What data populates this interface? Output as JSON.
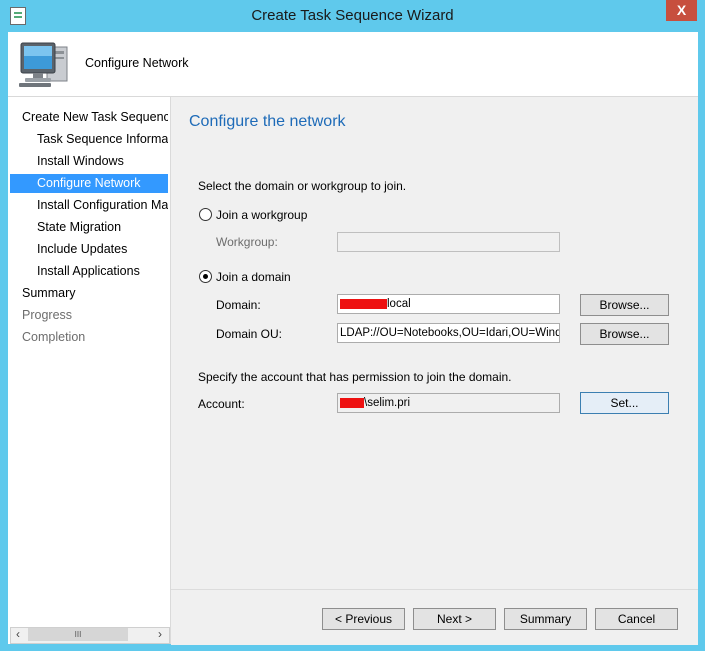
{
  "window": {
    "title": "Create Task Sequence Wizard",
    "close_glyph": "X"
  },
  "header": {
    "title": "Configure Network",
    "icon": "computer-icon"
  },
  "nav": {
    "items": [
      {
        "label": "Create New Task Sequence",
        "state": "normal"
      },
      {
        "label": "Task Sequence Information",
        "state": "normal"
      },
      {
        "label": "Install Windows",
        "state": "normal"
      },
      {
        "label": "Configure Network",
        "state": "selected"
      },
      {
        "label": "Install Configuration Manager",
        "state": "normal"
      },
      {
        "label": "State Migration",
        "state": "normal"
      },
      {
        "label": "Include Updates",
        "state": "normal"
      },
      {
        "label": "Install Applications",
        "state": "normal"
      },
      {
        "label": "Summary",
        "state": "normal"
      },
      {
        "label": "Progress",
        "state": "disabled"
      },
      {
        "label": "Completion",
        "state": "disabled"
      }
    ],
    "scroll_thumb_glyph": "III"
  },
  "page": {
    "heading": "Configure the network",
    "instruction": "Select the domain or workgroup to join.",
    "workgroup_option": "Join a workgroup",
    "workgroup_label": "Workgroup:",
    "workgroup_value": "",
    "domain_option": "Join a domain",
    "selected_option": "domain",
    "domain_label": "Domain:",
    "domain_value_suffix": "local",
    "domain_ou_label": "Domain OU:",
    "domain_ou_value": "LDAP://OU=Notebooks,OU=Idari,OU=Windows",
    "browse_label": "Browse...",
    "account_instruction": "Specify the account that has permission to join the domain.",
    "account_label": "Account:",
    "account_value_suffix": "\\selim.pri",
    "set_label": "Set..."
  },
  "buttons": {
    "previous": "< Previous",
    "next": "Next >",
    "summary": "Summary",
    "cancel": "Cancel"
  },
  "colors": {
    "titlebar": "#5fc9ec",
    "selected": "#3399ff",
    "heading": "#1e6bb8",
    "redaction": "#ee1111"
  }
}
